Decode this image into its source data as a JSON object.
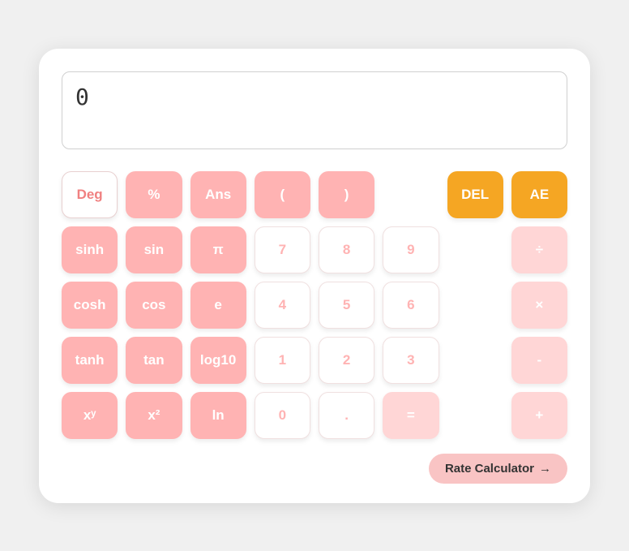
{
  "display": {
    "value": "0"
  },
  "buttons": [
    [
      {
        "label": "Deg",
        "type": "outline",
        "name": "deg-button"
      },
      {
        "label": "%",
        "type": "pink",
        "name": "percent-button"
      },
      {
        "label": "Ans",
        "type": "pink",
        "name": "ans-button"
      },
      {
        "label": "(",
        "type": "pink",
        "name": "open-paren-button"
      },
      {
        "label": ")",
        "type": "pink",
        "name": "close-paren-button"
      },
      {
        "label": "",
        "type": "spacer",
        "name": "spacer1"
      },
      {
        "label": "DEL",
        "type": "orange",
        "name": "del-button"
      },
      {
        "label": "AE",
        "type": "orange",
        "name": "ae-button"
      }
    ],
    [
      {
        "label": "sinh",
        "type": "pink",
        "name": "sinh-button"
      },
      {
        "label": "sin",
        "type": "pink",
        "name": "sin-button"
      },
      {
        "label": "π",
        "type": "pink",
        "name": "pi-button"
      },
      {
        "label": "7",
        "type": "white",
        "name": "seven-button"
      },
      {
        "label": "8",
        "type": "white",
        "name": "eight-button"
      },
      {
        "label": "9",
        "type": "white",
        "name": "nine-button"
      },
      {
        "label": "",
        "type": "spacer",
        "name": "spacer2"
      },
      {
        "label": "÷",
        "type": "light-pink",
        "name": "divide-button"
      }
    ],
    [
      {
        "label": "cosh",
        "type": "pink",
        "name": "cosh-button"
      },
      {
        "label": "cos",
        "type": "pink",
        "name": "cos-button"
      },
      {
        "label": "e",
        "type": "pink",
        "name": "e-button"
      },
      {
        "label": "4",
        "type": "white",
        "name": "four-button"
      },
      {
        "label": "5",
        "type": "white",
        "name": "five-button"
      },
      {
        "label": "6",
        "type": "white",
        "name": "six-button"
      },
      {
        "label": "",
        "type": "spacer",
        "name": "spacer3"
      },
      {
        "label": "×",
        "type": "light-pink",
        "name": "multiply-button"
      }
    ],
    [
      {
        "label": "tanh",
        "type": "pink",
        "name": "tanh-button"
      },
      {
        "label": "tan",
        "type": "pink",
        "name": "tan-button"
      },
      {
        "label": "log10",
        "type": "pink",
        "name": "log10-button"
      },
      {
        "label": "1",
        "type": "white",
        "name": "one-button"
      },
      {
        "label": "2",
        "type": "white",
        "name": "two-button"
      },
      {
        "label": "3",
        "type": "white",
        "name": "three-button"
      },
      {
        "label": "",
        "type": "spacer",
        "name": "spacer4"
      },
      {
        "label": "-",
        "type": "light-pink",
        "name": "minus-button"
      }
    ],
    [
      {
        "label": "xʸ",
        "type": "pink",
        "name": "xy-button"
      },
      {
        "label": "x²",
        "type": "pink",
        "name": "x2-button"
      },
      {
        "label": "ln",
        "type": "pink",
        "name": "ln-button"
      },
      {
        "label": "0",
        "type": "white",
        "name": "zero-button"
      },
      {
        "label": ".",
        "type": "white",
        "name": "dot-button"
      },
      {
        "label": "=",
        "type": "light-pink",
        "name": "equals-button"
      },
      {
        "label": "",
        "type": "spacer",
        "name": "spacer5"
      },
      {
        "label": "+",
        "type": "light-pink",
        "name": "plus-button"
      }
    ]
  ],
  "rate_calculator": {
    "label": "Rate Calculator",
    "arrow": "→"
  }
}
